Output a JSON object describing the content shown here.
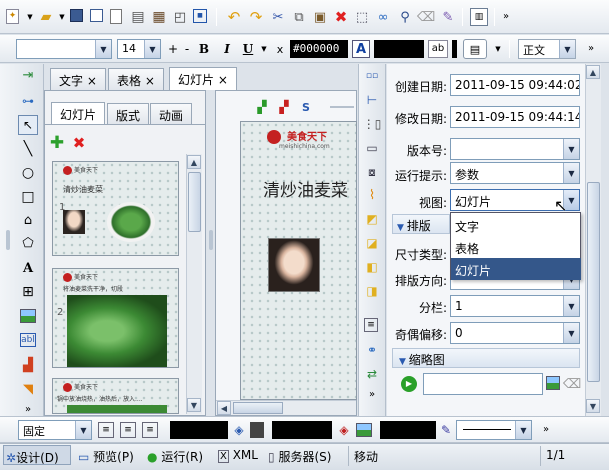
{
  "toolbar2": {
    "font_size": "14",
    "plus": "+",
    "minus": "-",
    "bold": "B",
    "italic": "I",
    "underline": "U",
    "color_hex": "#000000",
    "view_mode": "正文"
  },
  "doc_tabs": [
    {
      "label": "文字 ×"
    },
    {
      "label": "表格 ×"
    },
    {
      "label": "幻灯片 ×"
    }
  ],
  "sub_tabs": [
    {
      "label": "幻灯片"
    },
    {
      "label": "版式"
    },
    {
      "label": "动画"
    }
  ],
  "slides": [
    {
      "num": "1",
      "logo": "美食天下",
      "title": "清炒油麦菜"
    },
    {
      "num": "2",
      "logo": "美食天下",
      "title": "将油麦菜洗干净，切段"
    },
    {
      "num": "",
      "logo": "美食天下",
      "title": "锅中放油烧热，油热后，放入...."
    }
  ],
  "canvas": {
    "logo_text": "美食天下",
    "logo_sub": "meishichina.com",
    "title": "清炒油麦菜"
  },
  "props": {
    "created_label": "创建日期:",
    "created_value": "2011-09-15 09:44:02",
    "modified_label": "修改日期:",
    "modified_value": "2011-09-15 09:44:14",
    "version_label": "版本号:",
    "version_value": "",
    "hint_label": "运行提示:",
    "hint_value": "参数",
    "view_label": "视图:",
    "view_value": "幻灯片",
    "layout_section": "排版",
    "size_label": "尺寸类型:",
    "direction_label": "排版方向:",
    "columns_label": "分栏:",
    "columns_value": "1",
    "odd_offset_label": "奇偶偏移:",
    "odd_offset_value": "0",
    "thumbnail_section": "缩略图"
  },
  "view_dropdown": {
    "options": [
      "文字",
      "表格",
      "幻灯片"
    ],
    "selected": "幻灯片"
  },
  "bottom_toolbar": {
    "position": "固定"
  },
  "statusbar": {
    "design": "设计(D)",
    "preview": "预览(P)",
    "run": "运行(R)",
    "xml": "XML",
    "server": "服务器(S)",
    "mode": "移动",
    "page": "1/1"
  }
}
